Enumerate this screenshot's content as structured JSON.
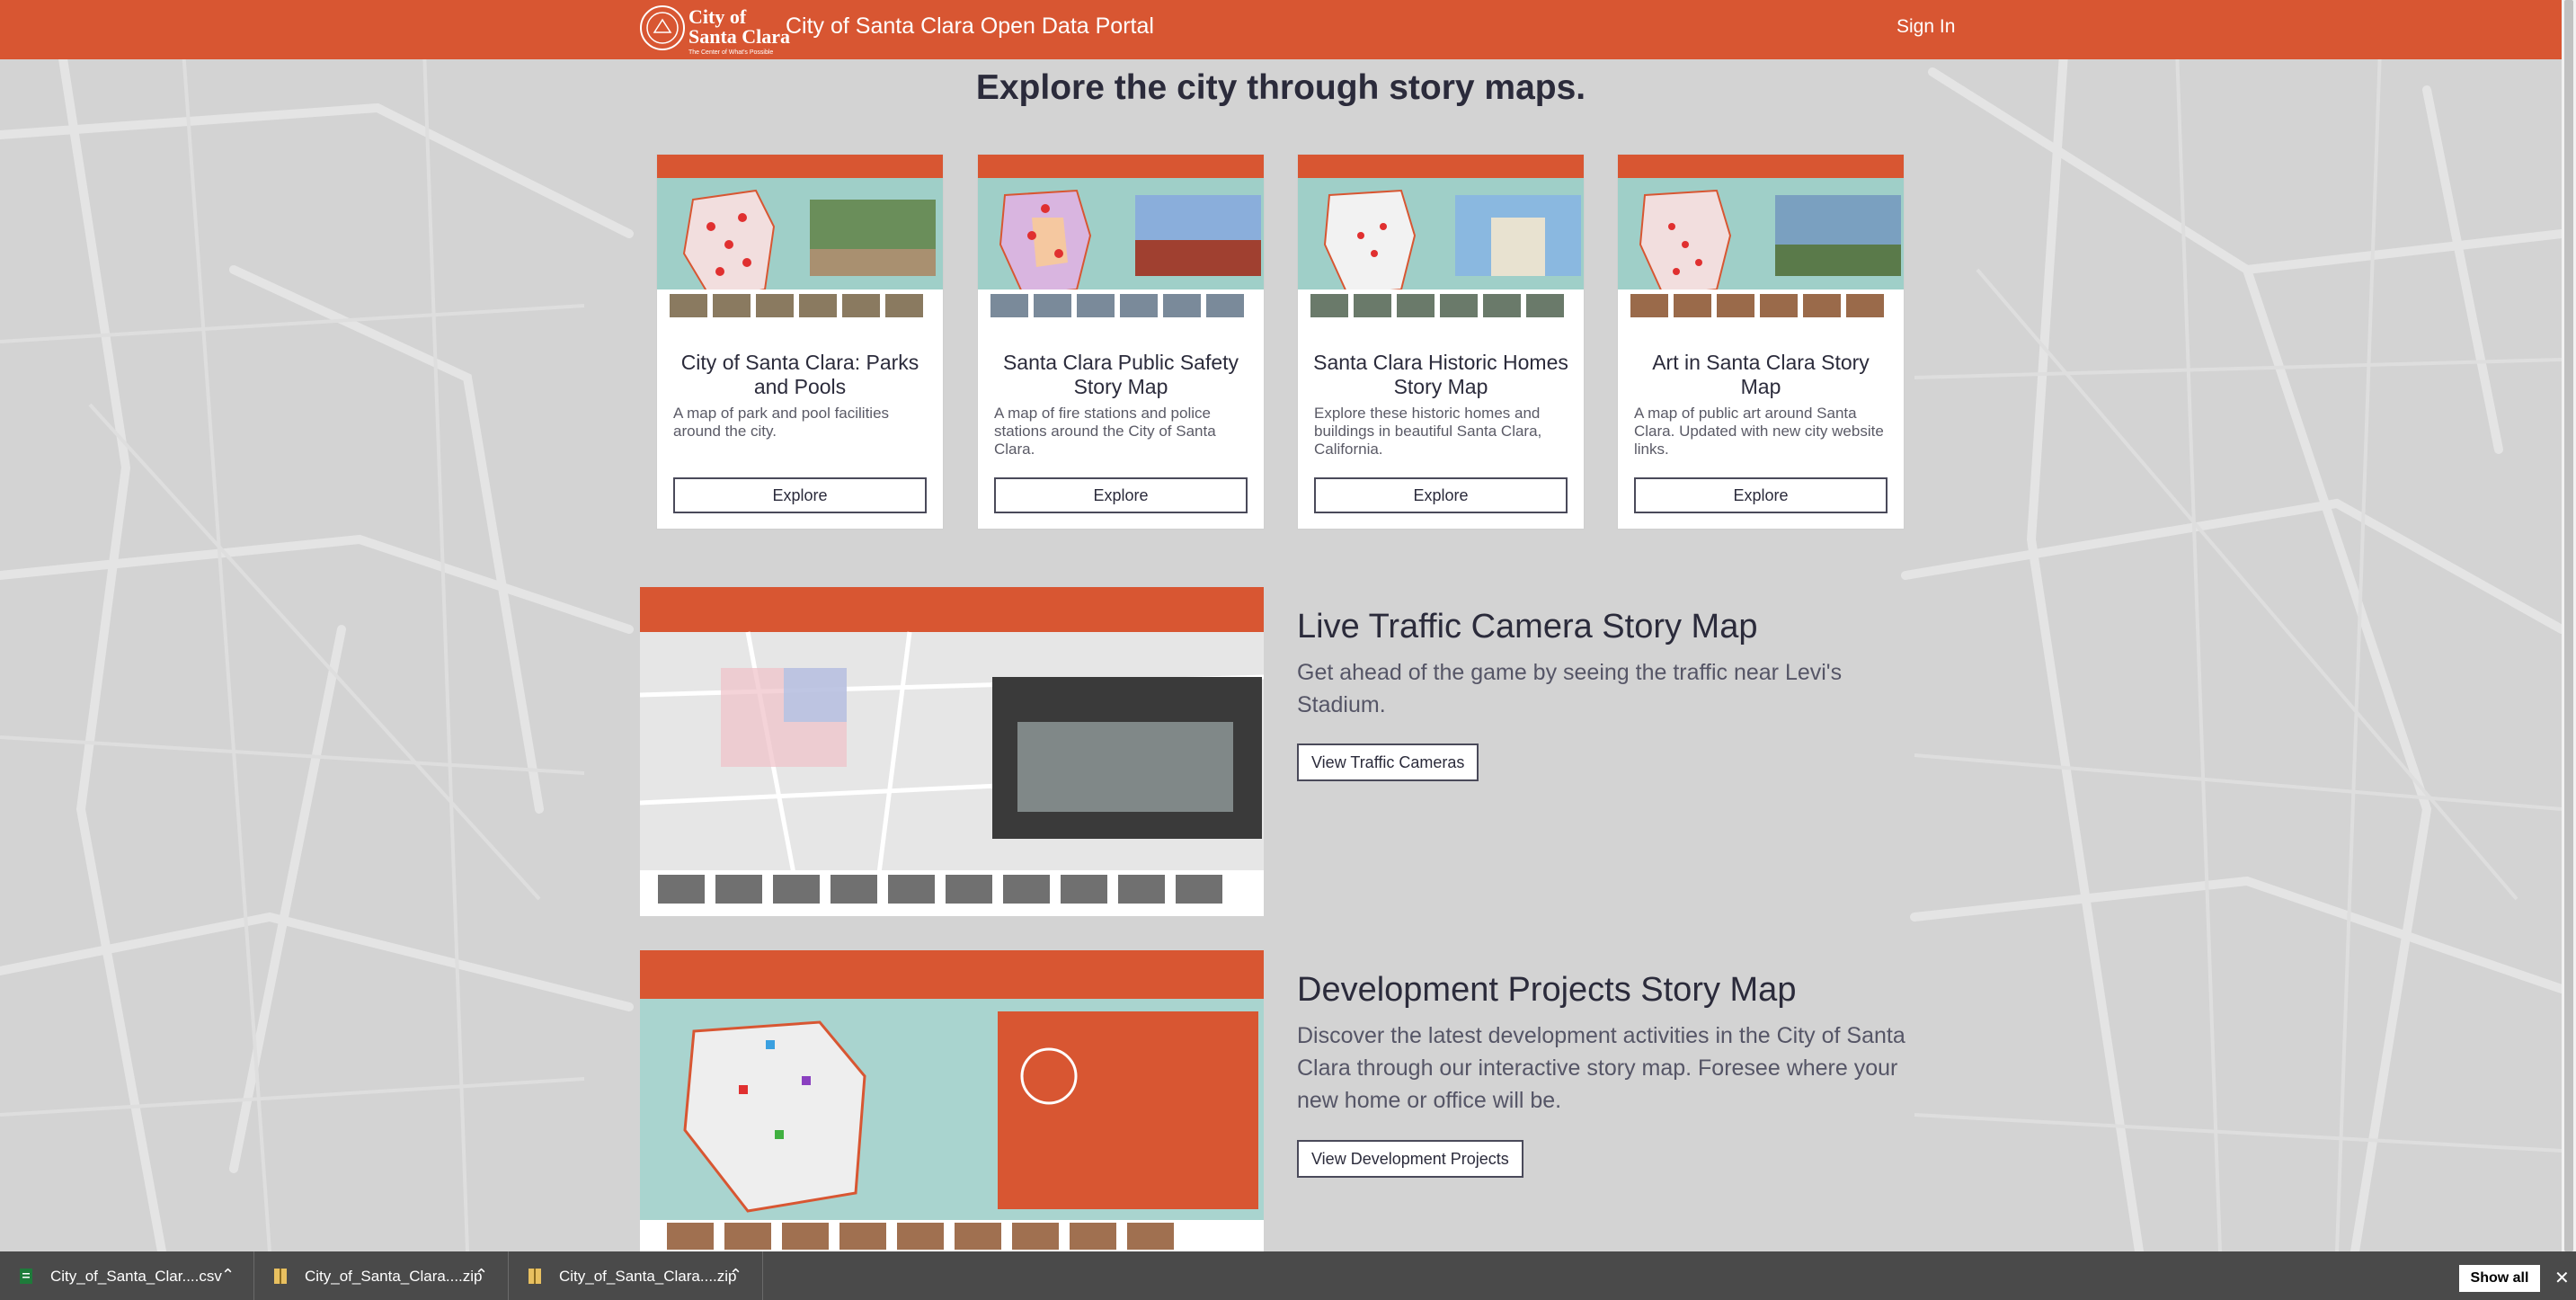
{
  "header": {
    "logo_line1": "City of",
    "logo_line2": "Santa Clara",
    "logo_tagline": "The Center of What's Possible",
    "portal_title": "City of Santa Clara Open Data Portal",
    "sign_in": "Sign In"
  },
  "section": {
    "heading": "Explore the city through story maps."
  },
  "cards": [
    {
      "title": "City of Santa Clara: Parks and Pools",
      "desc": "A map of park and pool facilities around the city.",
      "button": "Explore"
    },
    {
      "title": "Santa Clara Public Safety Story Map",
      "desc": "A map of fire stations and police stations around the City of Santa Clara.",
      "button": "Explore"
    },
    {
      "title": "Santa Clara Historic Homes Story Map",
      "desc": "Explore these historic homes and buildings in beautiful Santa Clara, California.",
      "button": "Explore"
    },
    {
      "title": "Art in Santa Clara Story Map",
      "desc": "A map of public art around Santa Clara. Updated with new city website links.",
      "button": "Explore"
    }
  ],
  "features": [
    {
      "title": "Live Traffic Camera Story Map",
      "desc": "Get ahead of the game by seeing the traffic near Levi's Stadium.",
      "button": "View Traffic Cameras"
    },
    {
      "title": "Development Projects Story Map",
      "desc": "Discover the latest development activities in the City of Santa Clara through our interactive story map. Foresee where your new home or office will be.",
      "button": "View Development Projects"
    }
  ],
  "downloads": {
    "items": [
      {
        "name": "City_of_Santa_Clar....csv",
        "icon": "csv-file-icon"
      },
      {
        "name": "City_of_Santa_Clara....zip",
        "icon": "zip-file-icon"
      },
      {
        "name": "City_of_Santa_Clara....zip",
        "icon": "zip-file-icon"
      }
    ],
    "show_all": "Show all",
    "close": "✕"
  },
  "colors": {
    "brand": "#d85632",
    "background": "#d3d3d3",
    "text": "#2b2b3b"
  }
}
